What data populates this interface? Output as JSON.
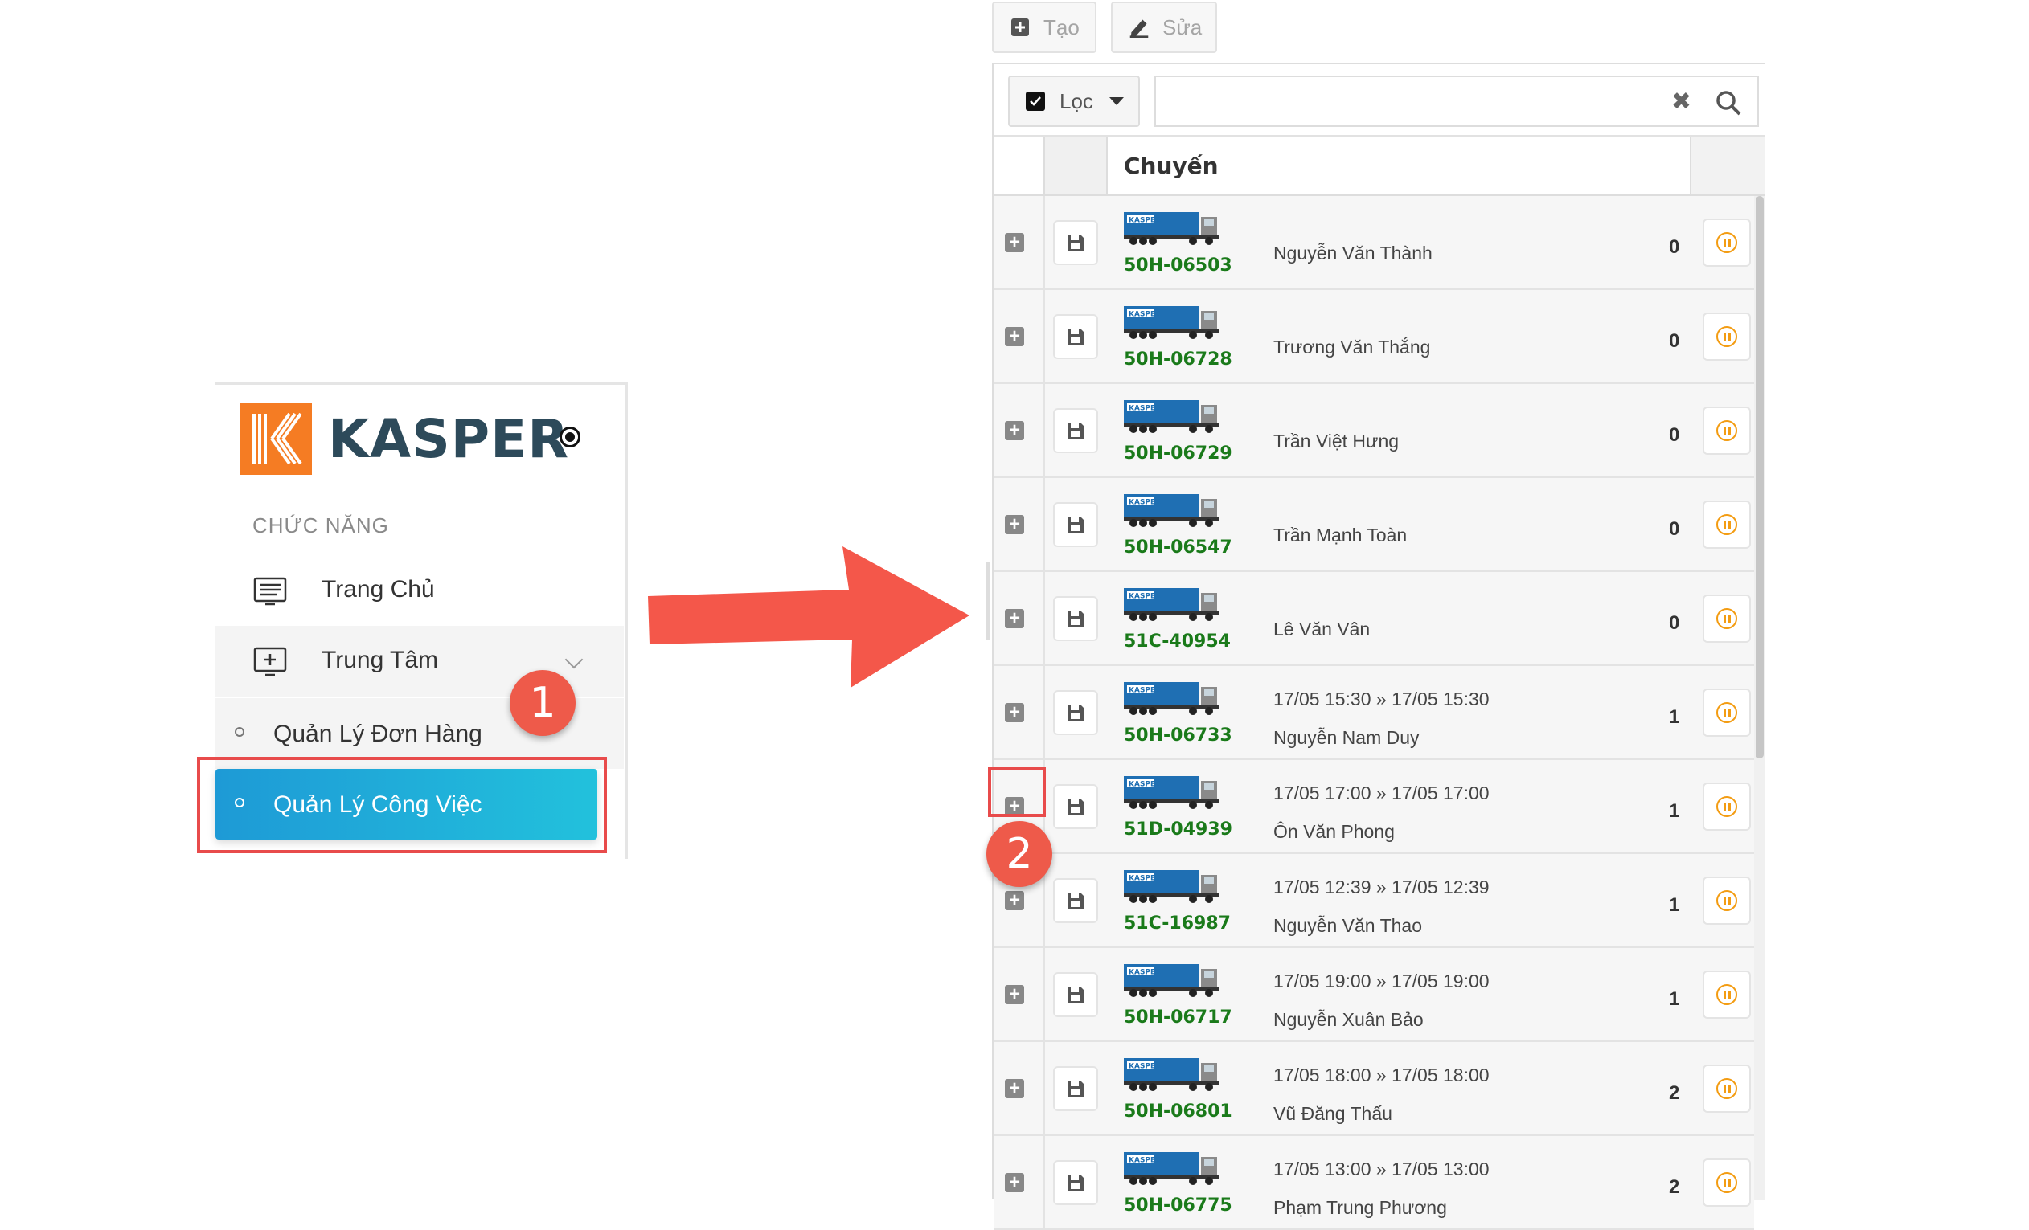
{
  "sidebar": {
    "brand_name": "KASPER",
    "section_heading": "CHỨC NĂNG",
    "items": [
      {
        "label": "Trang Chủ",
        "icon": "dashboard-icon"
      },
      {
        "label": "Trung Tâm",
        "icon": "monitor-plus-icon"
      }
    ],
    "sub_items": [
      {
        "label": "Quản Lý Đơn Hàng"
      },
      {
        "label": "Quản Lý Công Việc",
        "active": true
      }
    ]
  },
  "annotations": {
    "step1": "1",
    "step2": "2"
  },
  "toolbar": {
    "create_label": "Tạo",
    "edit_label": "Sửa"
  },
  "filter": {
    "label": "Lọc",
    "checked": true,
    "search_value": ""
  },
  "grid": {
    "column_header": "Chuyến",
    "rows": [
      {
        "plate": "50H-06503",
        "time": "",
        "driver": "Nguyễn Văn Thành",
        "count": "0"
      },
      {
        "plate": "50H-06728",
        "time": "",
        "driver": "Trương Văn Thắng",
        "count": "0"
      },
      {
        "plate": "50H-06729",
        "time": "",
        "driver": "Trần Việt Hưng",
        "count": "0"
      },
      {
        "plate": "50H-06547",
        "time": "",
        "driver": "Trần Mạnh Toàn",
        "count": "0"
      },
      {
        "plate": "51C-40954",
        "time": "",
        "driver": "Lê Văn Vân",
        "count": "0"
      },
      {
        "plate": "50H-06733",
        "time": "17/05 15:30 » 17/05 15:30",
        "driver": "Nguyễn Nam Duy",
        "count": "1"
      },
      {
        "plate": "51D-04939",
        "time": "17/05 17:00 » 17/05 17:00",
        "driver": "Ôn Văn Phong",
        "count": "1"
      },
      {
        "plate": "51C-16987",
        "time": "17/05 12:39 » 17/05 12:39",
        "driver": "Nguyễn Văn Thao",
        "count": "1"
      },
      {
        "plate": "50H-06717",
        "time": "17/05 19:00 » 17/05 19:00",
        "driver": "Nguyễn Xuân Bảo",
        "count": "1"
      },
      {
        "plate": "50H-06801",
        "time": "17/05 18:00 » 17/05 18:00",
        "driver": "Vũ Đăng Thấu",
        "count": "2"
      },
      {
        "plate": "50H-06775",
        "time": "17/05 13:00 » 17/05 13:00",
        "driver": "Phạm Trung Phương",
        "count": "2"
      }
    ]
  },
  "colors": {
    "brand_orange": "#f57c23",
    "active_gradient_start": "#1e9ad6",
    "active_gradient_end": "#22c1dc",
    "plate_green": "#1a7a1a",
    "callout_red": "#ee5a4a",
    "action_orange": "#f39c12"
  }
}
